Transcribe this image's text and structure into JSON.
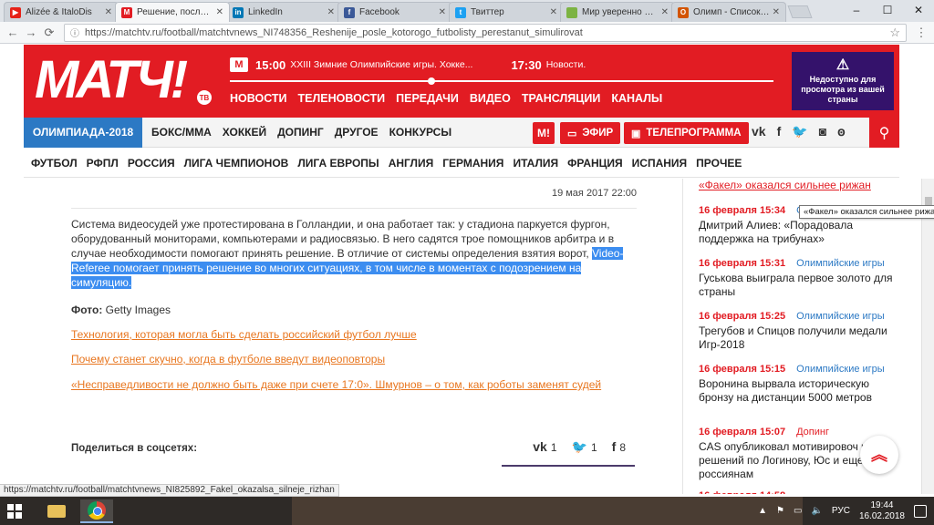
{
  "browser": {
    "tabs": [
      {
        "label": "Alizée & ItaloDis",
        "fav_color": "#e62117",
        "fav_glyph": "▶",
        "active": false
      },
      {
        "label": "Решение, после ко",
        "fav_color": "#e21c23",
        "fav_glyph": "M",
        "active": true
      },
      {
        "label": "LinkedIn",
        "fav_color": "#0077b5",
        "fav_glyph": "in",
        "active": false
      },
      {
        "label": "Facebook",
        "fav_color": "#3b5998",
        "fav_glyph": "f",
        "active": false
      },
      {
        "label": "Твиттер",
        "fav_color": "#1da1f2",
        "fav_glyph": "t",
        "active": false
      },
      {
        "label": "Мир уверенно пол",
        "fav_color": "#7cb342",
        "fav_glyph": "",
        "active": false
      },
      {
        "label": "Олимп - Список ст",
        "fav_color": "#d35400",
        "fav_glyph": "O",
        "active": false
      }
    ],
    "url": "https://matchtv.ru/football/matchtvnews_NI748356_Reshenije_posle_kotorogo_futbolisty_perestanut_simulirovat",
    "status_url": "https://matchtv.ru/football/matchtvnews_NI825892_Fakel_okazalsa_silneje_rizhan"
  },
  "header": {
    "logo": "МАТЧ!",
    "logo_badge": "ТВ",
    "ticker": [
      {
        "time": "15:00",
        "text": "XXIII Зимние Олимпийские игры. Хокке..."
      },
      {
        "time": "17:30",
        "text": "Новости."
      }
    ],
    "progress": 0.37,
    "nav": [
      "НОВОСТИ",
      "ТЕЛЕНОВОСТИ",
      "ПЕРЕДАЧИ",
      "ВИДЕО",
      "ТРАНСЛЯЦИИ",
      "КАНАЛЫ"
    ],
    "blocked_notice": "Недоступно для просмотра из вашей страны"
  },
  "secondary_nav": {
    "highlight": "ОЛИМПИАДА-2018",
    "items": [
      "БОКС/ММА",
      "ХОККЕЙ",
      "ДОПИНГ",
      "ДРУГОЕ",
      "КОНКУРСЫ"
    ],
    "match_badge": "М!",
    "efir_label": "ЭФИР",
    "tv_label": "ТЕЛЕПРОГРАММА"
  },
  "third_nav": [
    "ФУТБОЛ",
    "РФПЛ",
    "РОССИЯ",
    "ЛИГА ЧЕМПИОНОВ",
    "ЛИГА ЕВРОПЫ",
    "АНГЛИЯ",
    "ГЕРМАНИЯ",
    "ИТАЛИЯ",
    "ФРАНЦИЯ",
    "ИСПАНИЯ",
    "ПРОЧЕЕ"
  ],
  "article": {
    "date": "19 мая 2017 22:00",
    "para_plain": "Система видеосудей уже протестирована в Голландии, и она работает так: у стадиона паркуется фургон, оборудованный мониторами, компьютерами и радиосвязью. В него садятся трое помощников арбитра и в случае необходимости помогают принять решение. В отличие от системы определения взятия ворот, ",
    "para_highlight": "Video-Referee помогает принять решение во многих ситуациях, в том числе в моментах с подозрением на симуляцию.",
    "photo_label": "Фото:",
    "photo_credit": " Getty Images",
    "related": [
      "Технология, которая могла быть сделать российский футбол лучше",
      "Почему станет скучно, когда в футболе введут видеоповторы",
      "«Несправедливости не должно быть даже при счете 17:0». Шмурнов – о том, как роботы заменят судей"
    ],
    "share_label": "Поделиться в соцсетях:",
    "share": [
      {
        "icon": "vk",
        "glyph": "vk",
        "count": "1"
      },
      {
        "icon": "twitter",
        "glyph": "🐦",
        "count": "1"
      },
      {
        "icon": "facebook",
        "glyph": "f",
        "count": "8"
      }
    ]
  },
  "sidebar": {
    "top_link": "«Факел» оказался сильнее рижан",
    "tooltip": "«Факел» оказался сильнее рижан",
    "news": [
      {
        "time": "16 февраля 15:34",
        "category": "О",
        "title": "Дмитрий Алиев: «Порадовала поддержка на трибунах»"
      },
      {
        "time": "16 февраля 15:31",
        "category": "Олимпийские игры",
        "title": "Гуськова выиграла первое золото для страны"
      },
      {
        "time": "16 февраля 15:25",
        "category": "Олимпийские игры",
        "title": "Трегубов и Спицов получили медали Игр-2018"
      },
      {
        "time": "16 февраля 15:15",
        "category": "Олимпийские игры",
        "title": "Воронина вырвала историческую бронзу на дистанции 5000 метров"
      },
      {
        "time": "16 февраля 15:07",
        "category": "Допинг",
        "title": "CAS опубликовал мотивировоч часть решений по Логинову, Юс и еще 11 россиянам"
      },
      {
        "time": "16 февраля 14:58",
        "category": "",
        "title": ""
      }
    ]
  },
  "taskbar": {
    "lang": "РУС",
    "time": "19:44",
    "date": "16.02.2018"
  }
}
